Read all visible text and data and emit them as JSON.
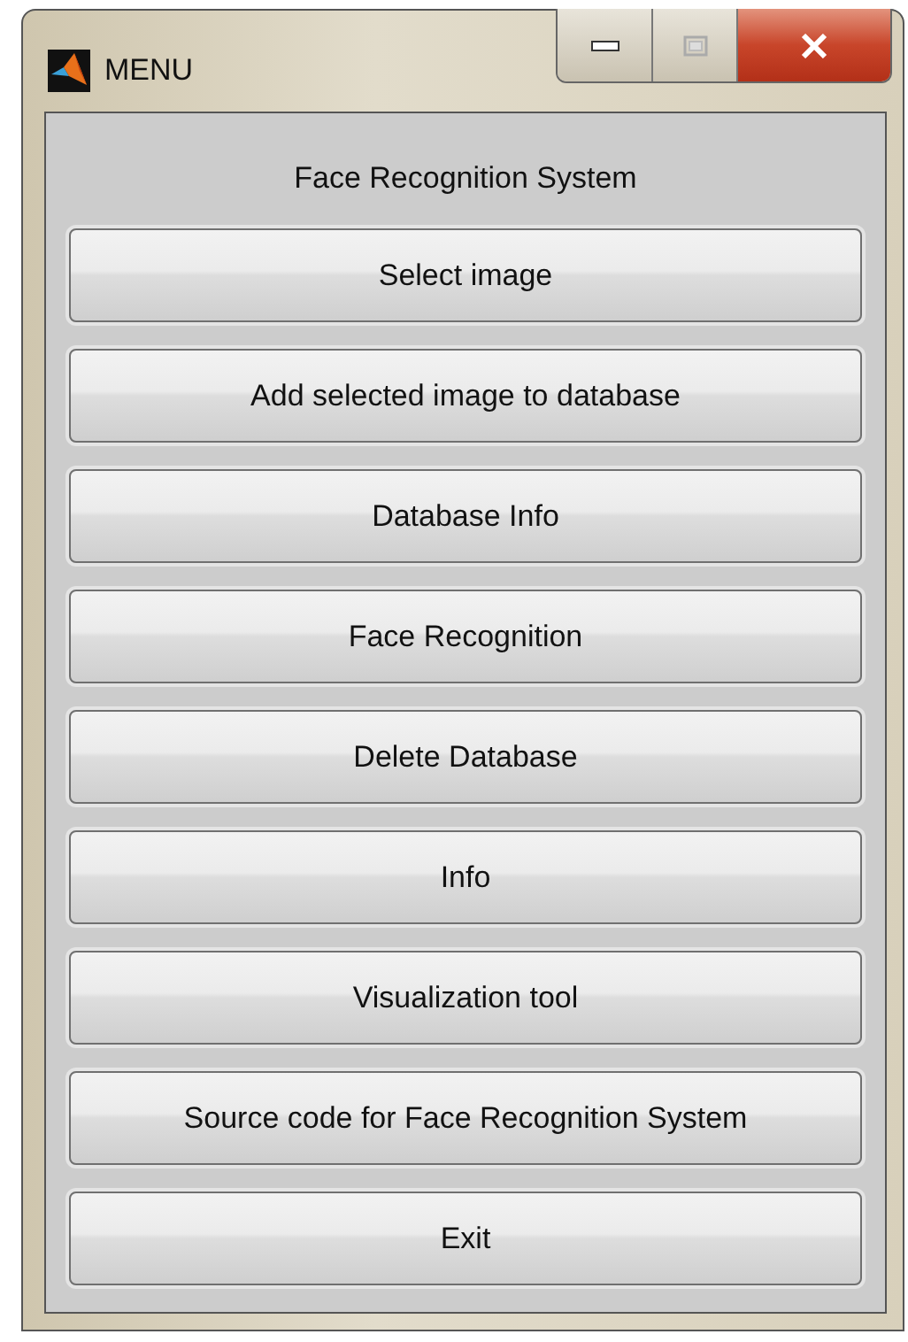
{
  "window": {
    "title": "MENU"
  },
  "heading": "Face Recognition System",
  "buttons": [
    "Select image",
    "Add selected image to database",
    "Database Info",
    "Face Recognition",
    "Delete Database",
    "Info",
    "Visualization tool",
    "Source code for Face Recognition System",
    "Exit"
  ]
}
